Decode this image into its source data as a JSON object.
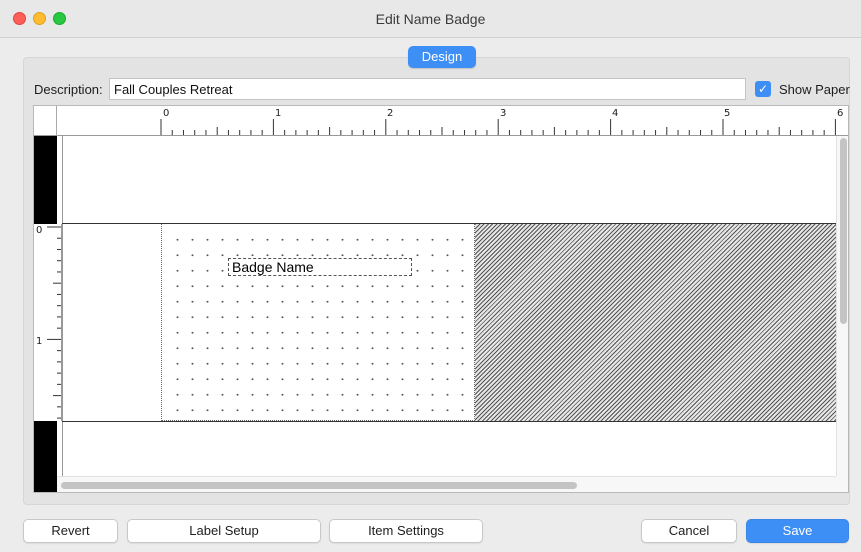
{
  "window": {
    "title": "Edit Name Badge"
  },
  "tabs": {
    "design": "Design"
  },
  "description": {
    "label": "Description:",
    "value": "Fall Couples Retreat"
  },
  "show_paper": {
    "label": "Show Paper",
    "checked": true,
    "check_glyph": "✓"
  },
  "ruler": {
    "top_numbers": [
      "0",
      "1",
      "2",
      "3",
      "4",
      "5",
      "6"
    ],
    "left_numbers": [
      "0",
      "1"
    ]
  },
  "badge": {
    "field_text": "Badge Name"
  },
  "buttons": {
    "revert": "Revert",
    "label_setup": "Label Setup",
    "item_settings": "Item Settings",
    "cancel": "Cancel",
    "save": "Save"
  },
  "colors": {
    "accent": "#3d8ff5"
  }
}
